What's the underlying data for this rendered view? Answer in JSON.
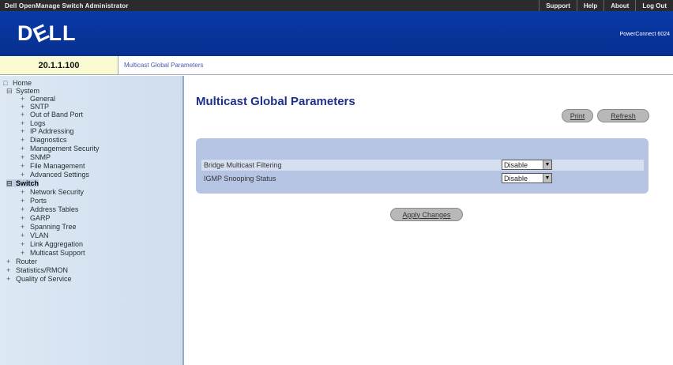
{
  "header": {
    "app_title": "Dell OpenManage Switch Administrator",
    "links": [
      "Support",
      "Help",
      "About",
      "Log Out"
    ],
    "logo": "DÉLL",
    "product": "PowerConnect 6024"
  },
  "address": {
    "ip": "20.1.1.100",
    "breadcrumb": "Multicast Global Parameters"
  },
  "tree": {
    "home": "Home",
    "system": "System",
    "system_items": [
      "General",
      "SNTP",
      "Out of Band Port",
      "Logs",
      "IP Addressing",
      "Diagnostics",
      "Management Security",
      "SNMP",
      "File Management",
      "Advanced Settings"
    ],
    "switch": "Switch",
    "switch_items": [
      "Network Security",
      "Ports",
      "Address Tables",
      "GARP",
      "Spanning Tree",
      "VLAN",
      "Link Aggregation",
      "Multicast Support"
    ],
    "bottom_items": [
      "Router",
      "Statistics/RMON",
      "Quality of Service"
    ]
  },
  "main": {
    "title": "Multicast Global Parameters",
    "print_label": "Print",
    "refresh_label": "Refresh",
    "rows": [
      {
        "label": "Bridge Multicast Filtering",
        "value": "Disable"
      },
      {
        "label": "IGMP Snooping Status",
        "value": "Disable"
      }
    ],
    "apply_label": "Apply Changes"
  }
}
